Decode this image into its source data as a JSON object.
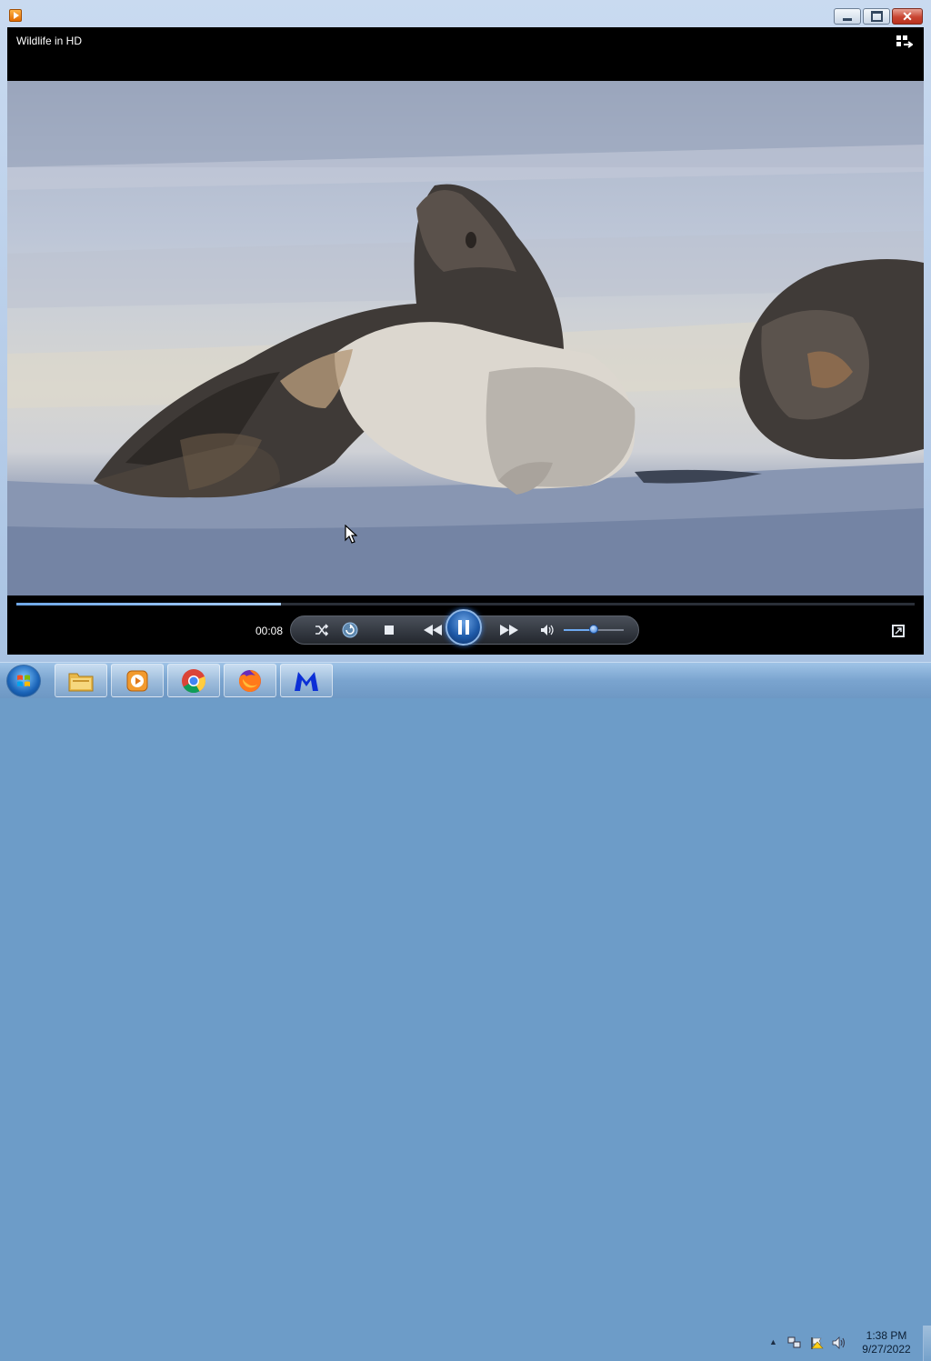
{
  "window": {
    "title": "Wildlife in HD",
    "icon": "media-player-icon",
    "controls": [
      "minimize",
      "maximize",
      "close"
    ]
  },
  "player": {
    "current_time": "00:08",
    "progress": 0.295,
    "volume": 0.5,
    "state": "playing",
    "controls": [
      "shuffle-icon",
      "repeat-icon",
      "stop-icon",
      "previous-icon",
      "pause-icon",
      "next-icon",
      "volume-icon",
      "volume-slider"
    ],
    "accent_color": "#3a7bd5"
  },
  "taskbar": {
    "pinned": [
      "explorer-icon",
      "media-player-icon",
      "chrome-icon",
      "firefox-icon",
      "malwarebytes-icon"
    ],
    "tray": [
      "network-icon",
      "action-center-flag-icon",
      "speaker-icon"
    ],
    "clock": {
      "time": "1:38 PM",
      "date": "9/27/2022"
    }
  }
}
